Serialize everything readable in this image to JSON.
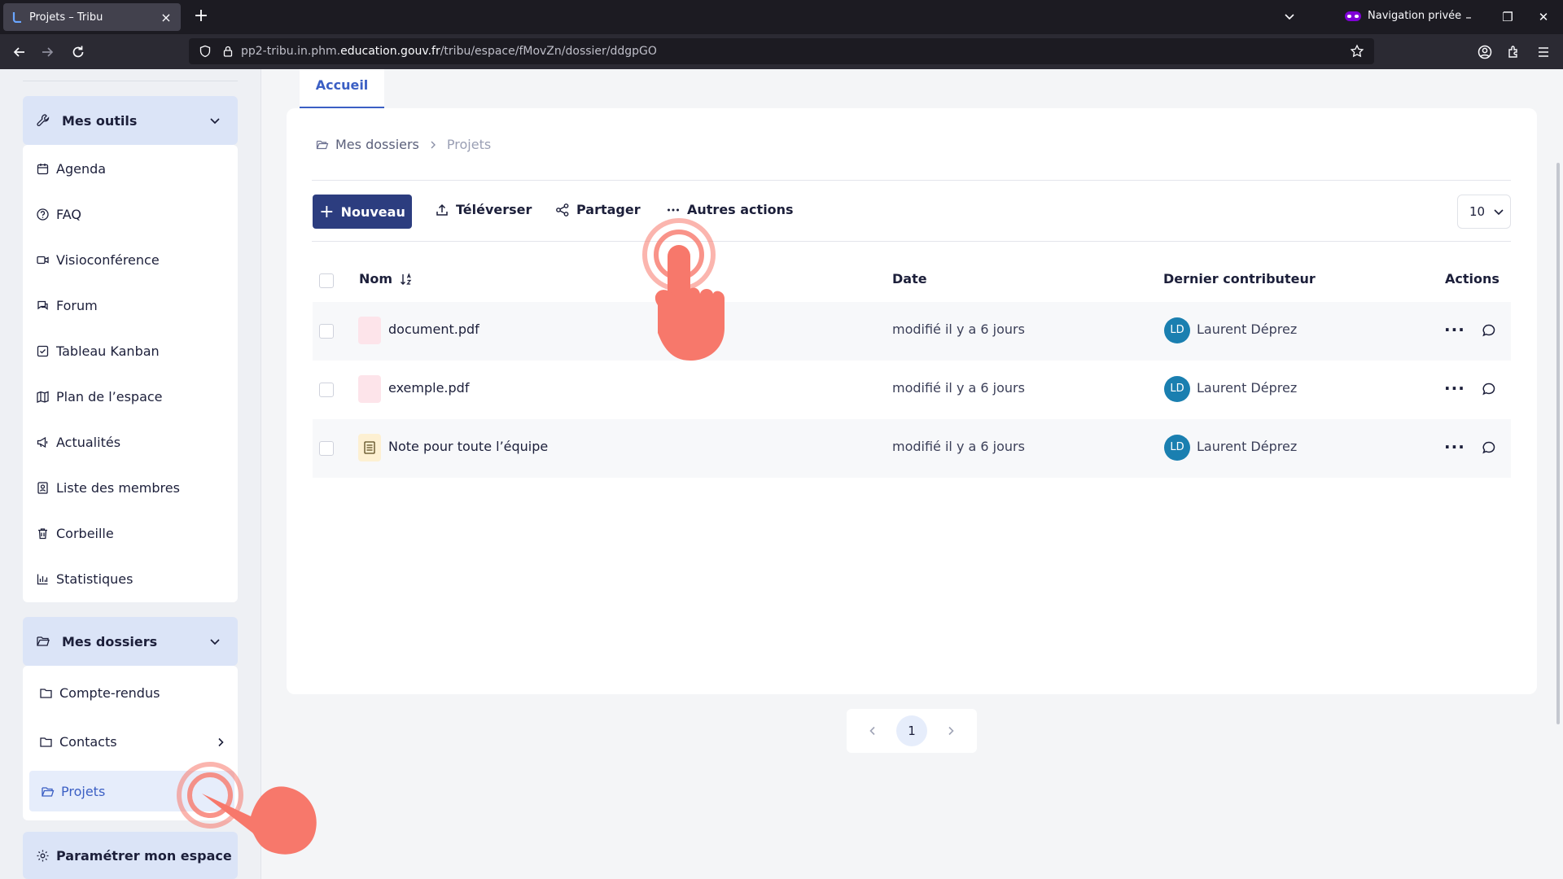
{
  "browser": {
    "tab_title": "Projets – Tribu",
    "private_label": "Navigation privée",
    "url_prefix": "pp2-tribu.in.phm.",
    "url_domain": "education.gouv.fr",
    "url_path": "/tribu/espace/fMovZn/dossier/ddgpGO"
  },
  "sidebar": {
    "tools_header": "Mes outils",
    "tools": [
      {
        "label": "Agenda",
        "icon": "calendar-icon"
      },
      {
        "label": "FAQ",
        "icon": "question-icon"
      },
      {
        "label": "Visioconférence",
        "icon": "video-icon"
      },
      {
        "label": "Forum",
        "icon": "forum-icon"
      },
      {
        "label": "Tableau Kanban",
        "icon": "kanban-icon"
      },
      {
        "label": "Plan de l’espace",
        "icon": "map-icon"
      },
      {
        "label": "Actualités",
        "icon": "megaphone-icon"
      },
      {
        "label": "Liste des membres",
        "icon": "members-icon"
      },
      {
        "label": "Corbeille",
        "icon": "trash-icon"
      },
      {
        "label": "Statistiques",
        "icon": "stats-icon"
      }
    ],
    "folders_header": "Mes dossiers",
    "folders": [
      {
        "label": "Compte-rendus"
      },
      {
        "label": "Contacts"
      },
      {
        "label": "Projets"
      }
    ],
    "settings_label": "Paramétrer mon espace"
  },
  "main": {
    "tab_label": "Accueil",
    "breadcrumb": {
      "root": "Mes dossiers",
      "current": "Projets"
    },
    "toolbar": {
      "new_label": "Nouveau",
      "upload_label": "Téléverser",
      "share_label": "Partager",
      "more_label": "Autres actions",
      "per_page": "10"
    },
    "table": {
      "headers": {
        "name": "Nom",
        "date": "Date",
        "contributor": "Dernier contributeur",
        "actions": "Actions"
      },
      "rows": [
        {
          "name": "document.pdf",
          "date": "modifié il y a 6 jours",
          "initials": "LD",
          "contributor": "Laurent Déprez",
          "kind": "pdf"
        },
        {
          "name": "exemple.pdf",
          "date": "modifié il y a 6 jours",
          "initials": "LD",
          "contributor": "Laurent Déprez",
          "kind": "pdf"
        },
        {
          "name": "Note pour toute l’équipe",
          "date": "modifié il y a 6 jours",
          "initials": "LD",
          "contributor": "Laurent Déprez",
          "kind": "note"
        }
      ]
    },
    "pagination": {
      "current_page": "1"
    }
  },
  "colors": {
    "primary": "#2c3d7f",
    "accent": "#3b5fc4",
    "avatar": "#1a7fb0",
    "hand": "#f7786b"
  }
}
